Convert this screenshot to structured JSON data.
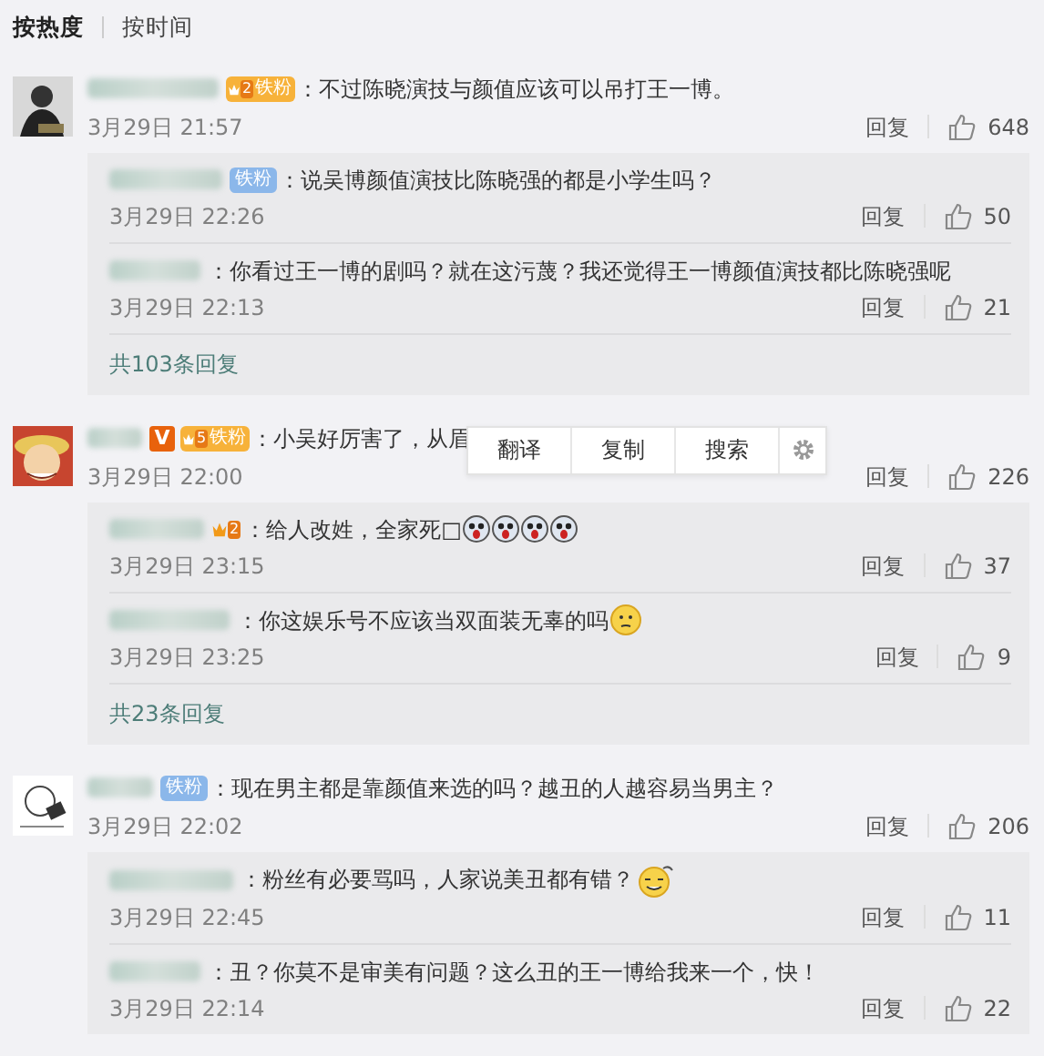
{
  "sort_tabs": [
    {
      "label": "按热度",
      "selected": true
    },
    {
      "label": "按时间",
      "selected": false
    }
  ],
  "comments": [
    {
      "avatar": {
        "kind": "figure"
      },
      "badges": [
        {
          "kind": "fan",
          "level": "2",
          "label": "铁粉"
        }
      ],
      "text": "：不过陈晓演技与颜值应该可以吊打王一博。",
      "time": "3月29日 21:57",
      "reply_label": "回复",
      "likes": "648",
      "more": "共103条回复",
      "replies": [
        {
          "badges": [
            {
              "kind": "fan_plain",
              "label": "铁粉"
            }
          ],
          "text": "：说吴博颜值演技比陈晓强的都是小学生吗？",
          "time": "3月29日 22:26",
          "reply_label": "回复",
          "likes": "50"
        },
        {
          "text": "：你看过王一博的剧吗？就在这污蔑？我还觉得王一博颜值演技都比陈晓强呢",
          "time": "3月29日 22:13",
          "reply_label": "回复",
          "likes": "21"
        }
      ]
    },
    {
      "avatar": {
        "kind": "cartoon"
      },
      "badges": [
        {
          "kind": "verified",
          "label": "V"
        },
        {
          "kind": "fan",
          "level": "5",
          "label": "铁粉"
        }
      ],
      "text": "：小吴好厉害了，从眉",
      "time": "3月29日 22:00",
      "reply_label": "回复",
      "likes": "226",
      "more": "共23条回复",
      "menu": [
        "翻译",
        "复制",
        "搜索"
      ],
      "replies": [
        {
          "badges": [
            {
              "kind": "crown",
              "level": "2"
            }
          ],
          "text": "：给人改姓，全家死□",
          "emojis": [
            {
              "kind": "dog"
            },
            {
              "kind": "dog"
            },
            {
              "kind": "dog"
            },
            {
              "kind": "dog"
            }
          ],
          "time": "3月29日 23:15",
          "reply_label": "回复",
          "likes": "37"
        },
        {
          "text": "：你这娱乐号不应该当双面装无辜的吗",
          "emojis": [
            {
              "kind": "thinking"
            }
          ],
          "time": "3月29日 23:25",
          "reply_label": "回复",
          "likes": "9"
        }
      ]
    },
    {
      "avatar": {
        "kind": "sketch"
      },
      "badges": [
        {
          "kind": "fan_plain",
          "label": "铁粉"
        }
      ],
      "text": "：现在男主都是靠颜值来选的吗？越丑的人越容易当男主？",
      "time": "3月29日 22:02",
      "reply_label": "回复",
      "likes": "206",
      "replies": [
        {
          "text": "：粉丝有必要骂吗，人家说美丑都有错？",
          "emojis": [
            {
              "kind": "dizzy"
            }
          ],
          "time": "3月29日 22:45",
          "reply_label": "回复",
          "likes": "11"
        },
        {
          "text": "：丑？你莫不是审美有问题？这么丑的王一博给我来一个，快！",
          "time": "3月29日 22:14",
          "reply_label": "回复",
          "likes": "22"
        }
      ]
    }
  ]
}
